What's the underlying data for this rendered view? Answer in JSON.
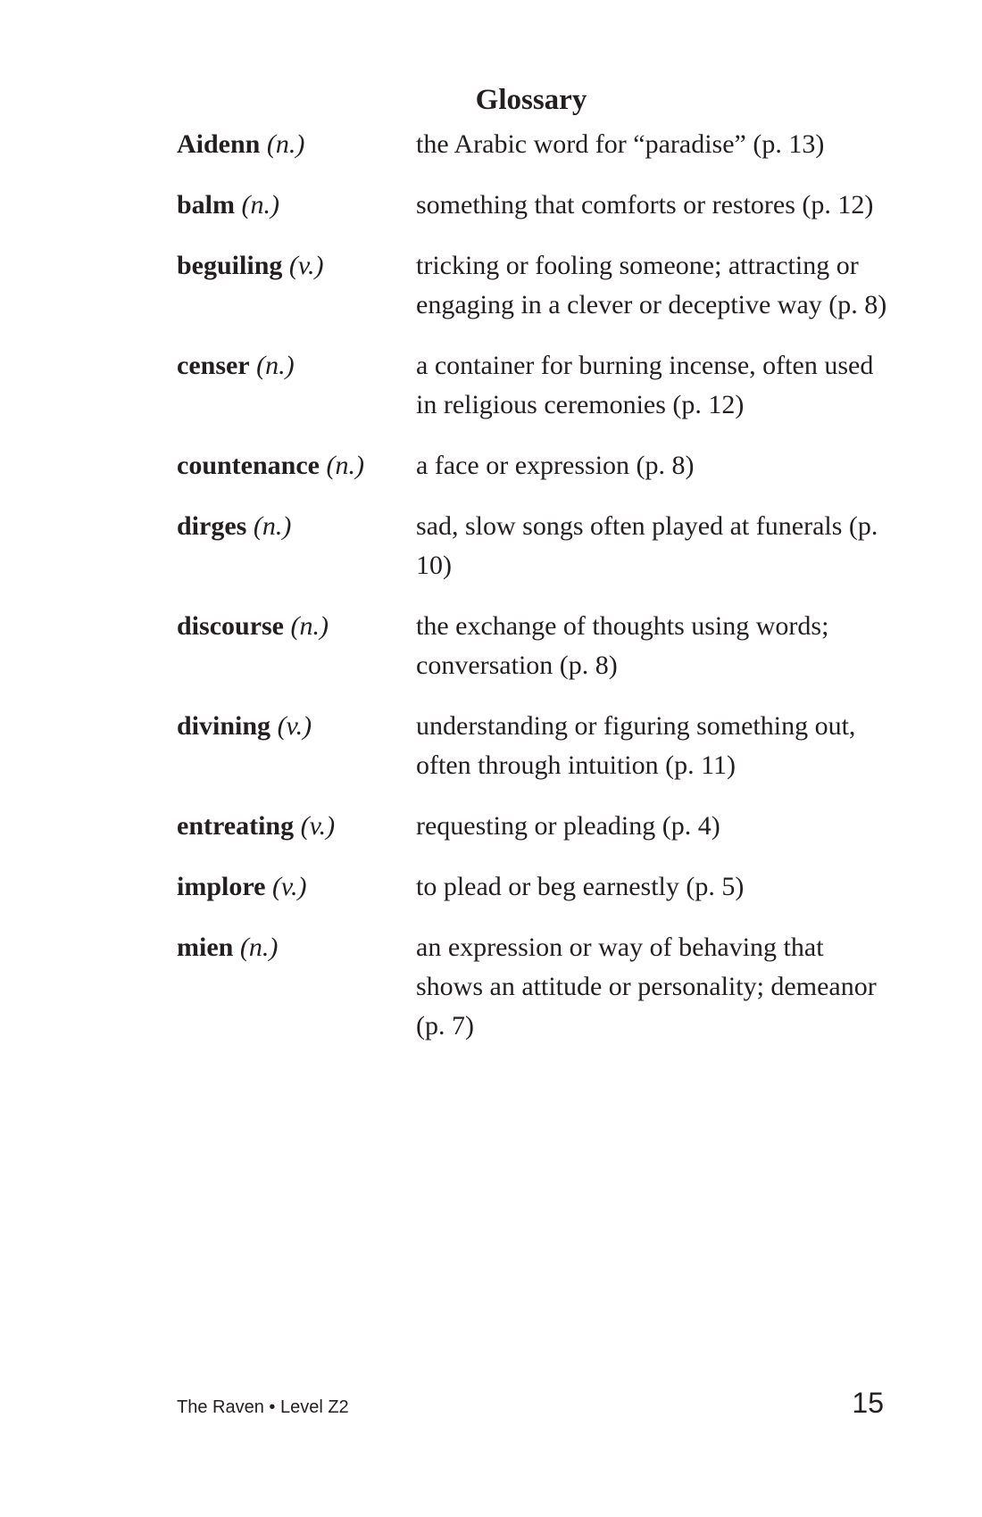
{
  "page": {
    "title": "Glossary",
    "footer_title": "The Raven • Level Z2",
    "page_number": "15"
  },
  "entries": [
    {
      "term": "Aidenn",
      "pos": "(n.)",
      "definition": "the Arabic word for “paradise” (p. 13)"
    },
    {
      "term": "balm",
      "pos": "(n.)",
      "definition": "something that comforts or restores (p. 12)"
    },
    {
      "term": "beguiling",
      "pos": "(v.)",
      "definition": "tricking or fooling someone; attracting or engaging in a clever or deceptive way (p. 8)"
    },
    {
      "term": "censer",
      "pos": "(n.)",
      "definition": "a container for burning incense, often used in religious ceremonies (p. 12)"
    },
    {
      "term": "countenance",
      "pos": "(n.)",
      "definition": "a face or expression (p. 8)"
    },
    {
      "term": "dirges",
      "pos": "(n.)",
      "definition": "sad, slow songs often played at funerals (p. 10)"
    },
    {
      "term": "discourse",
      "pos": "(n.)",
      "definition": "the exchange of thoughts using words; conversation (p. 8)"
    },
    {
      "term": "divining",
      "pos": "(v.)",
      "definition": "understanding or figuring something out, often through intuition (p. 11)"
    },
    {
      "term": "entreating",
      "pos": "(v.)",
      "definition": "requesting or pleading (p. 4)"
    },
    {
      "term": "implore",
      "pos": "(v.)",
      "definition": "to plead or beg earnestly (p. 5)"
    },
    {
      "term": "mien",
      "pos": "(n.)",
      "definition": "an expression or way of behaving that shows an attitude or personality; demeanor (p. 7)"
    }
  ]
}
